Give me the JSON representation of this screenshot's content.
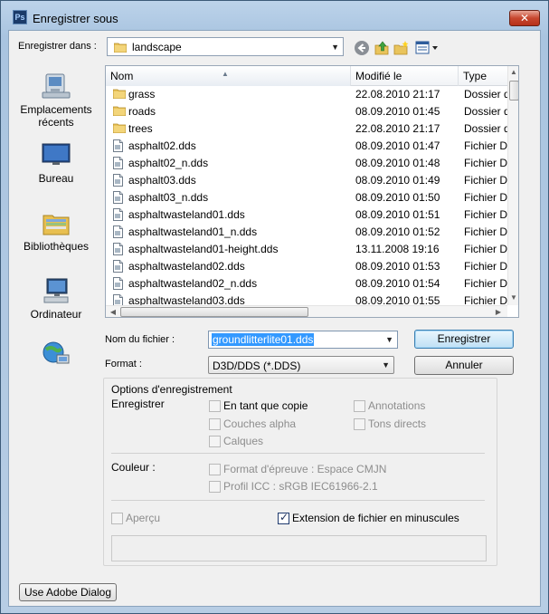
{
  "window": {
    "title": "Enregistrer sous",
    "app_icon": "Ps",
    "close": "✕"
  },
  "location": {
    "label": "Enregistrer dans :",
    "folder": "landscape"
  },
  "places": [
    {
      "label": "Emplacements récents",
      "icon": "recent-places-icon"
    },
    {
      "label": "Bureau",
      "icon": "desktop-icon"
    },
    {
      "label": "Bibliothèques",
      "icon": "libraries-icon"
    },
    {
      "label": "Ordinateur",
      "icon": "computer-icon"
    },
    {
      "label": "",
      "icon": "network-icon"
    }
  ],
  "columns": {
    "name": "Nom",
    "modified": "Modifié le",
    "type": "Type"
  },
  "files": [
    {
      "name": "grass",
      "modified": "22.08.2010 21:17",
      "type": "Dossier de fichiers",
      "kind": "folder"
    },
    {
      "name": "roads",
      "modified": "08.09.2010 01:45",
      "type": "Dossier de fichiers",
      "kind": "folder"
    },
    {
      "name": "trees",
      "modified": "22.08.2010 21:17",
      "type": "Dossier de fichiers",
      "kind": "folder"
    },
    {
      "name": "asphalt02.dds",
      "modified": "08.09.2010 01:47",
      "type": "Fichier DDS",
      "kind": "file"
    },
    {
      "name": "asphalt02_n.dds",
      "modified": "08.09.2010 01:48",
      "type": "Fichier DDS",
      "kind": "file"
    },
    {
      "name": "asphalt03.dds",
      "modified": "08.09.2010 01:49",
      "type": "Fichier DDS",
      "kind": "file"
    },
    {
      "name": "asphalt03_n.dds",
      "modified": "08.09.2010 01:50",
      "type": "Fichier DDS",
      "kind": "file"
    },
    {
      "name": "asphaltwasteland01.dds",
      "modified": "08.09.2010 01:51",
      "type": "Fichier DDS",
      "kind": "file"
    },
    {
      "name": "asphaltwasteland01_n.dds",
      "modified": "08.09.2010 01:52",
      "type": "Fichier DDS",
      "kind": "file"
    },
    {
      "name": "asphaltwasteland01-height.dds",
      "modified": "13.11.2008 19:16",
      "type": "Fichier DDS",
      "kind": "file"
    },
    {
      "name": "asphaltwasteland02.dds",
      "modified": "08.09.2010 01:53",
      "type": "Fichier DDS",
      "kind": "file"
    },
    {
      "name": "asphaltwasteland02_n.dds",
      "modified": "08.09.2010 01:54",
      "type": "Fichier DDS",
      "kind": "file"
    },
    {
      "name": "asphaltwasteland03.dds",
      "modified": "08.09.2010 01:55",
      "type": "Fichier DDS",
      "kind": "file"
    }
  ],
  "filename": {
    "label": "Nom du fichier :",
    "value": "groundlitterlite01.dds"
  },
  "format": {
    "label": "Format :",
    "value": "D3D/DDS (*.DDS)"
  },
  "buttons": {
    "save": "Enregistrer",
    "cancel": "Annuler",
    "adobe": "Use Adobe Dialog"
  },
  "options": {
    "title": "Options d'enregistrement",
    "save_label": "Enregistrer",
    "as_copy": "En tant que copie",
    "alpha": "Couches alpha",
    "layers": "Calques",
    "annotations": "Annotations",
    "spot": "Tons directs",
    "color_label": "Couleur :",
    "proof": "Format d'épreuve : Espace CMJN",
    "icc": "Profil ICC : sRGB IEC61966-2.1",
    "preview": "Aperçu",
    "lowercase_ext": "Extension de fichier en minuscules"
  }
}
